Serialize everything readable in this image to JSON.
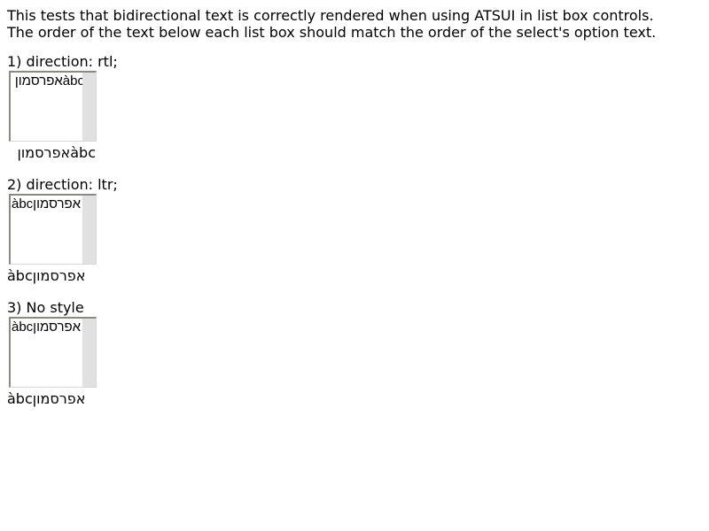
{
  "intro": {
    "line1": "This tests that bidirectional text is correctly rendered when using ATSUI in list box controls.",
    "line2": "The order of the text below each list box should match the order of the select's option text."
  },
  "sections": [
    {
      "label": "1) direction: rtl;",
      "option_text": "אפרסמוןàbc",
      "option_visual": "ןומסרפאàbc",
      "result_text": "ןומסרפאàbc"
    },
    {
      "label": "2) direction: ltr;",
      "option_text": "àbcאפרסמון",
      "option_visual": "àbcןומסרפא",
      "result_text": "àbcןומסרפא"
    },
    {
      "label": "3) No style",
      "option_text": "àbcאפרסמון",
      "option_visual": "àbcןומסרפא",
      "result_text": "àbcןומסרפא"
    }
  ]
}
